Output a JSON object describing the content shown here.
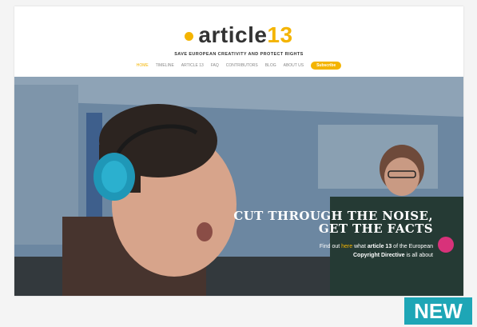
{
  "site": {
    "logo_text": "article",
    "logo_number": "13",
    "tagline": "SAVE EUROPEAN CREATIVITY AND PROTECT RIGHTS"
  },
  "nav": {
    "items": [
      "HOME",
      "TIMELINE",
      "ARTICLE 13",
      "FAQ",
      "CONTRIBUTORS",
      "BLOG",
      "ABOUT US"
    ],
    "cta": "Subscribe"
  },
  "hero": {
    "headline_1": "CUT THROUGH THE NOISE,",
    "headline_2": "GET THE FACTS",
    "sub_1_pre": "Find out",
    "sub_1_hl": "here",
    "sub_1_mid": "what",
    "sub_1_bold": "article 13",
    "sub_1_post": "of the European",
    "sub_2_bold": "Copyright Directive",
    "sub_2_post": "is all about"
  },
  "badge": {
    "label": "NEW"
  },
  "colors": {
    "accent": "#f4b400",
    "badge": "#1ea6b6"
  }
}
